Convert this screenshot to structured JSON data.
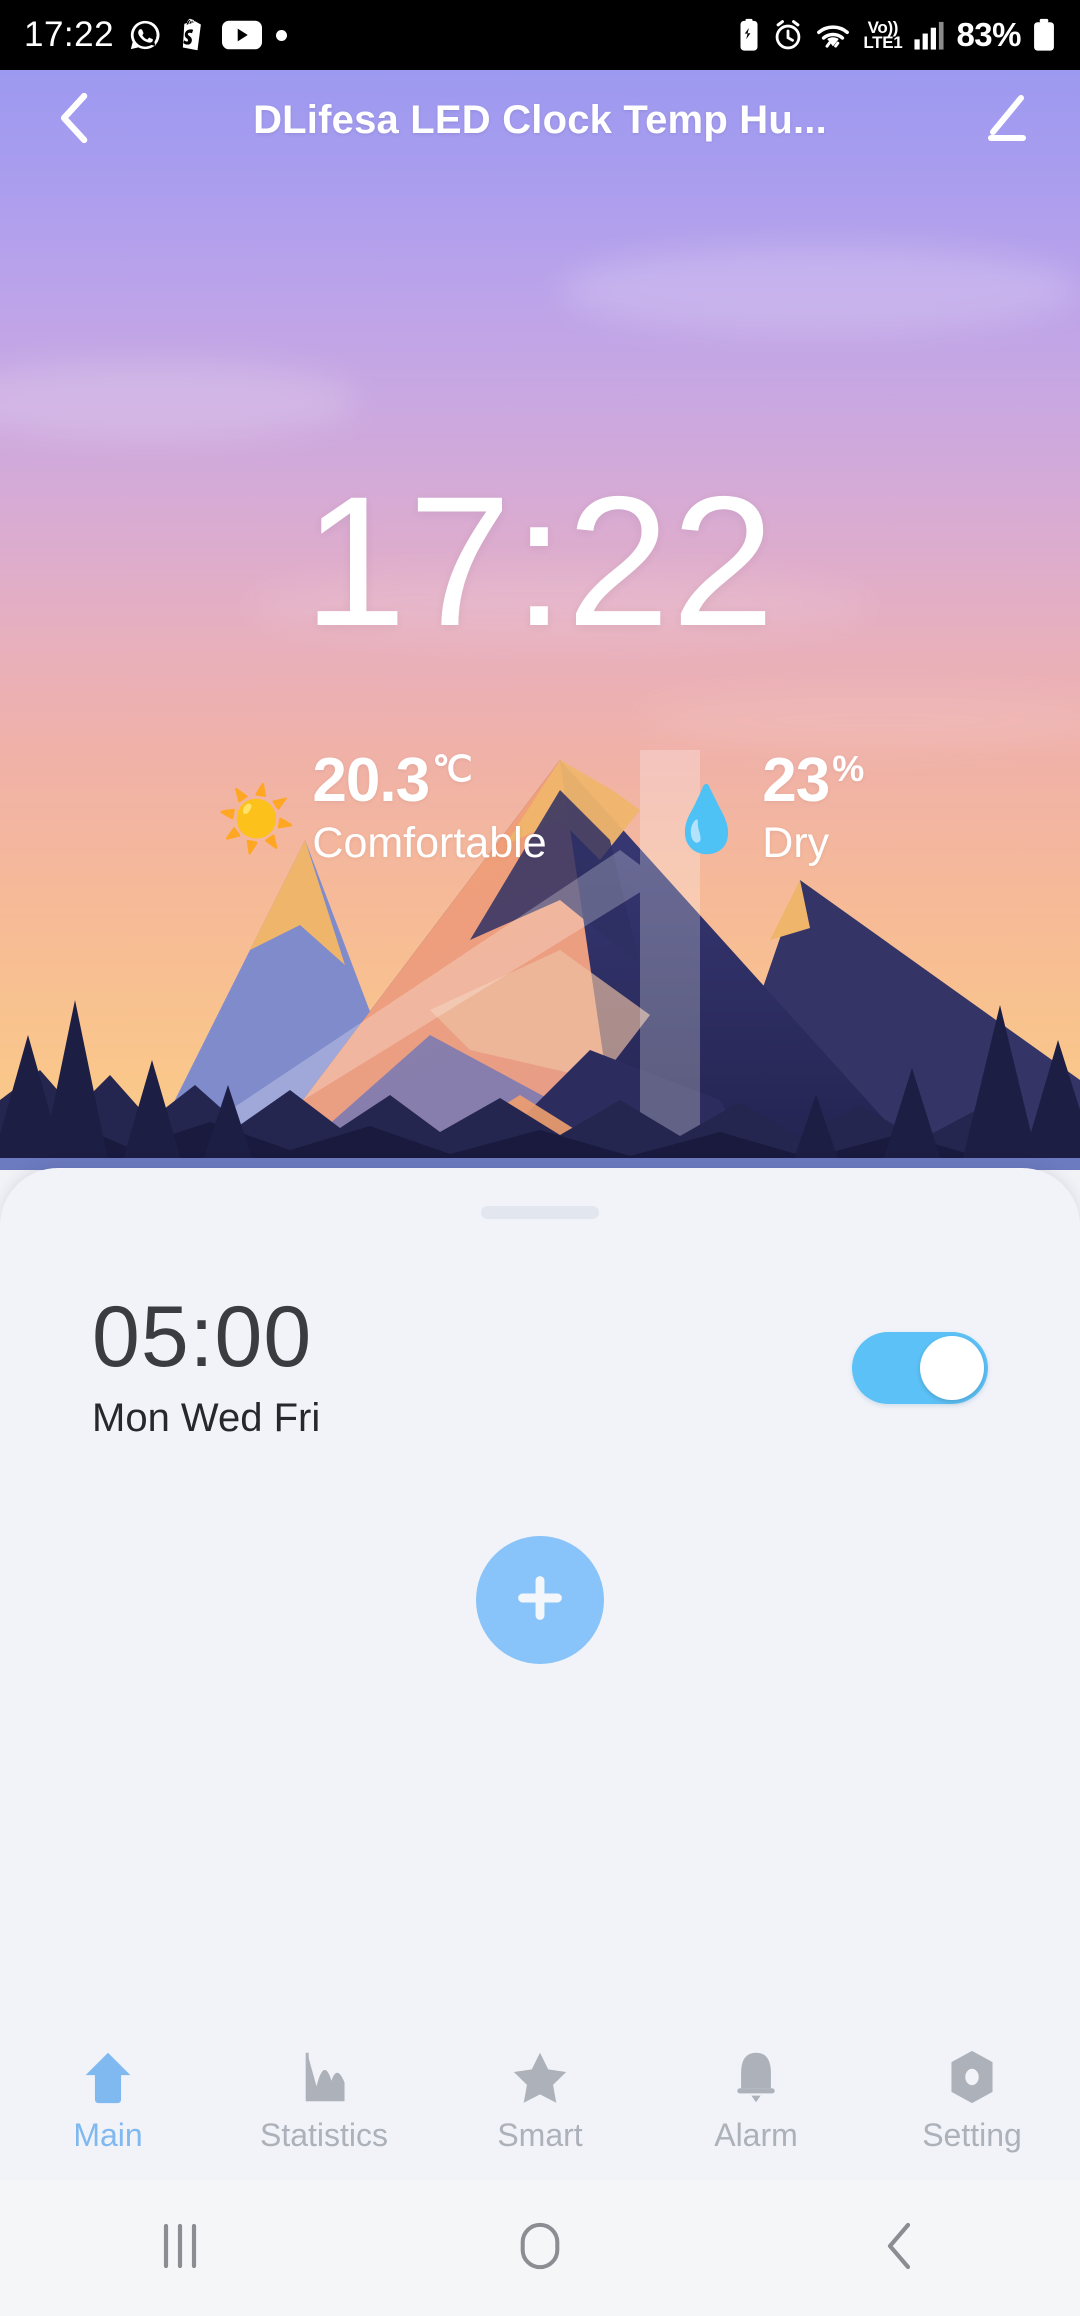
{
  "statusbar": {
    "time": "17:22",
    "battery_percent": "83%",
    "network": {
      "volte": "Vo))",
      "lte": "LTE1"
    },
    "left_icons": [
      "whatsapp-icon",
      "shopify-icon",
      "youtube-icon",
      "more-dot-icon"
    ],
    "right_icons": [
      "battery-saver-icon",
      "alarm-icon",
      "wifi-icon",
      "volte-icon",
      "signal-icon",
      "battery-icon"
    ]
  },
  "header": {
    "title": "DLifesa LED Clock Temp Hu...",
    "back_icon": "chevron-left-icon",
    "edit_icon": "pencil-icon"
  },
  "hero": {
    "clock": "17:22",
    "temperature": {
      "value": "20.3",
      "unit": "℃",
      "label": "Comfortable",
      "emoji": "☀️"
    },
    "humidity": {
      "value": "23",
      "unit": "%",
      "label": "Dry",
      "emoji": "💧"
    }
  },
  "sheet": {
    "drag_handle": "drag-handle",
    "alarms": [
      {
        "time": "05:00",
        "days": "Mon Wed Fri",
        "enabled": true
      }
    ],
    "add_label": "+"
  },
  "tabs": [
    {
      "label": "Main",
      "icon": "home-icon",
      "active": true
    },
    {
      "label": "Statistics",
      "icon": "chart-icon",
      "active": false
    },
    {
      "label": "Smart",
      "icon": "star-icon",
      "active": false
    },
    {
      "label": "Alarm",
      "icon": "bell-icon",
      "active": false
    },
    {
      "label": "Setting",
      "icon": "gear-icon",
      "active": false
    }
  ],
  "android_nav": {
    "recents": "recents-icon",
    "home": "home-square-icon",
    "back": "back-chevron-icon"
  },
  "colors": {
    "accent_blue": "#5CC1F7",
    "add_blue": "#88C4F9",
    "tab_active": "#7FB9F0",
    "tab_inactive": "#ACB1BA",
    "sheet_bg": "#F1F3F8",
    "gradient_top": "#9C9AF0",
    "gradient_bottom": "#FBCB8C"
  }
}
